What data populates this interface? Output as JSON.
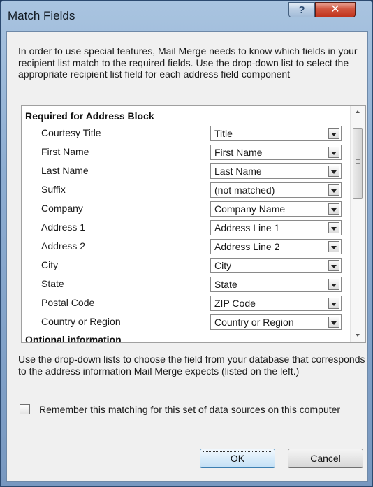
{
  "window": {
    "title": "Match Fields",
    "help_glyph": "?",
    "close_glyph": "✕"
  },
  "intro_text": "In order to use special features, Mail Merge needs to know which fields in your recipient list match to the required fields. Use the drop-down list to select the appropriate recipient list field for each address field component",
  "list": {
    "required_header": "Required for Address Block",
    "fields": [
      {
        "label": "Courtesy Title",
        "value": "Title"
      },
      {
        "label": "First Name",
        "value": "First Name"
      },
      {
        "label": "Last Name",
        "value": "Last Name"
      },
      {
        "label": "Suffix",
        "value": "(not matched)"
      },
      {
        "label": "Company",
        "value": "Company Name"
      },
      {
        "label": "Address 1",
        "value": "Address Line 1"
      },
      {
        "label": "Address 2",
        "value": "Address Line 2"
      },
      {
        "label": "City",
        "value": "City"
      },
      {
        "label": "State",
        "value": "State"
      },
      {
        "label": "Postal Code",
        "value": "ZIP Code"
      },
      {
        "label": "Country or Region",
        "value": "Country or Region"
      }
    ],
    "optional_header": "Optional information"
  },
  "help_text": "Use the drop-down lists to choose the field from your database that corresponds to the address information Mail Merge expects (listed on the left.)",
  "remember_checkbox": {
    "accel_letter": "R",
    "label_rest": "emember this matching for this set of data sources on this computer",
    "checked": false
  },
  "buttons": {
    "ok": "OK",
    "cancel": "Cancel"
  },
  "icons": {
    "dropdown": "chevron-down-icon",
    "scroll_up": "scroll-up-icon",
    "scroll_down": "scroll-down-icon"
  }
}
